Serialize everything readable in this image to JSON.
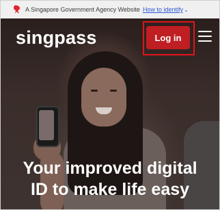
{
  "gov_banner": {
    "text": "A Singapore Government Agency Website",
    "link": "How to identify",
    "chevron": "⌄"
  },
  "header": {
    "logo": "singpass",
    "login_label": "Log in",
    "menu_icon": "hamburger-menu-icon"
  },
  "hero": {
    "line1": "Your improved digital",
    "line2": "ID to make life easy"
  },
  "colors": {
    "accent": "#bf1e22",
    "highlight_outline": "#e4141b",
    "gov_link": "#2b57d6"
  }
}
